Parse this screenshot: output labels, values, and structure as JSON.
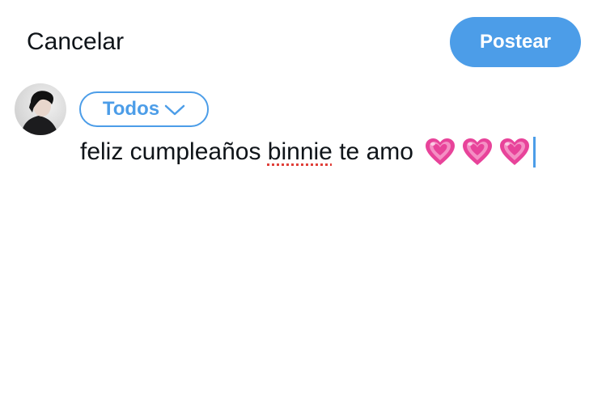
{
  "header": {
    "cancel_label": "Cancelar",
    "post_label": "Postear"
  },
  "audience": {
    "label": "Todos",
    "icon": "chevron-down-icon"
  },
  "composer": {
    "text_before": "feliz cumpleaños ",
    "misspelled_word": "binnie",
    "text_after": " te amo",
    "emoji": [
      "growing-heart",
      "growing-heart",
      "growing-heart"
    ]
  },
  "colors": {
    "accent": "#4c9de8",
    "text": "#0f1419",
    "spellcheck": "#e0403a",
    "heart": "#e8439a"
  }
}
